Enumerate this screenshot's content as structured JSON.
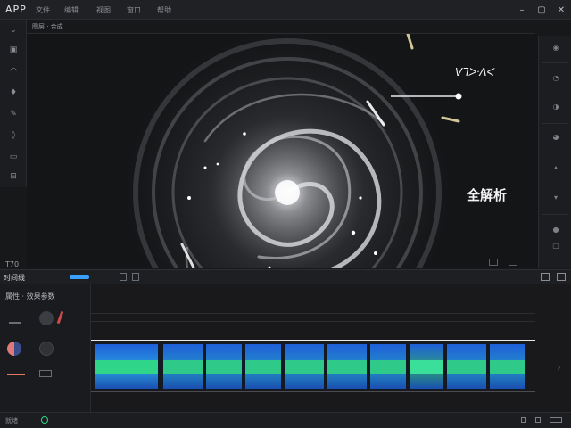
{
  "menubar": {
    "app_title": "APP",
    "items": [
      "文件",
      "编辑",
      "视图",
      "窗口",
      "帮助"
    ]
  },
  "subbar": {
    "label": "图层 · 合成"
  },
  "viewport": {
    "label_top": "ᐯᒣᐳᐧᐱᐸ",
    "label_mid": "全解析",
    "caption": "T70"
  },
  "timeline": {
    "title": "时间线",
    "panel_header": "属性 · 效果参数"
  },
  "status": {
    "left": "就绪"
  },
  "colors": {
    "accent": "#3aa0ff",
    "clip_teal": "#2fd68a",
    "clip_blue": "#1f5cd6"
  }
}
